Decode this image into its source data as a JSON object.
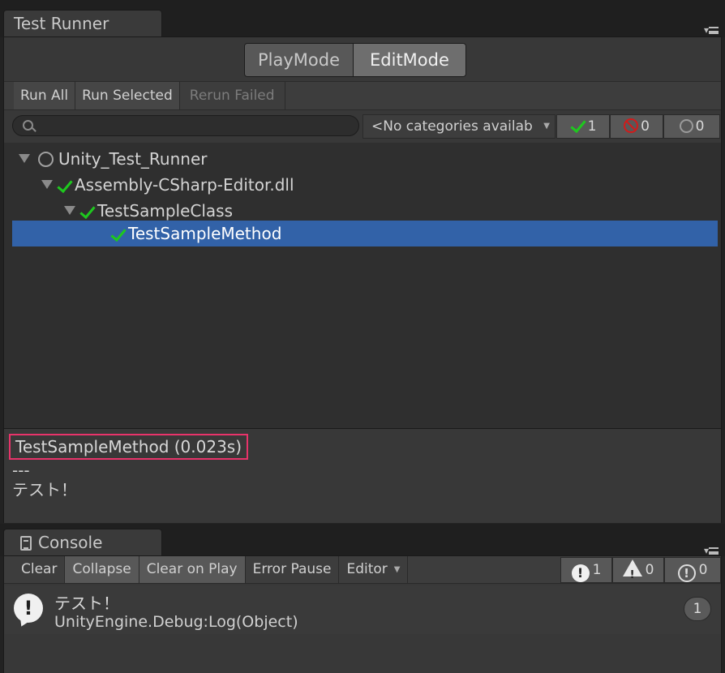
{
  "test_runner": {
    "tab_title": "Test Runner",
    "modes": [
      {
        "label": "PlayMode",
        "active": false
      },
      {
        "label": "EditMode",
        "active": true
      }
    ],
    "toolbar": {
      "run_all": "Run All",
      "run_selected": "Run Selected",
      "rerun_failed": "Rerun Failed"
    },
    "search": {
      "placeholder": ""
    },
    "category_dropdown": "<No categories availab",
    "counters": {
      "passed": "1",
      "failed": "0",
      "not_run": "0"
    },
    "tree": [
      {
        "label": "Unity_Test_Runner",
        "status": "not-run"
      },
      {
        "label": "Assembly-CSharp-Editor.dll",
        "status": "passed"
      },
      {
        "label": "TestSampleClass",
        "status": "passed"
      },
      {
        "label": "TestSampleMethod",
        "status": "passed",
        "selected": true
      }
    ],
    "details": {
      "title": "TestSampleMethod (0.023s)",
      "separator": "---",
      "message": "テスト！"
    }
  },
  "console": {
    "tab_title": "Console",
    "toolbar": {
      "clear": "Clear",
      "collapse": "Collapse",
      "clear_on_play": "Clear on Play",
      "error_pause": "Error Pause",
      "editor": "Editor"
    },
    "counters": {
      "info": "1",
      "warnings": "0",
      "errors": "0"
    },
    "entries": [
      {
        "line1": "テスト！",
        "line2": "UnityEngine.Debug:Log(Object)",
        "count": "1"
      }
    ]
  },
  "colors": {
    "selection": "#3262a8",
    "pass": "#1ec81e",
    "fail": "#d21a1a",
    "highlight_box": "#e8336a"
  }
}
